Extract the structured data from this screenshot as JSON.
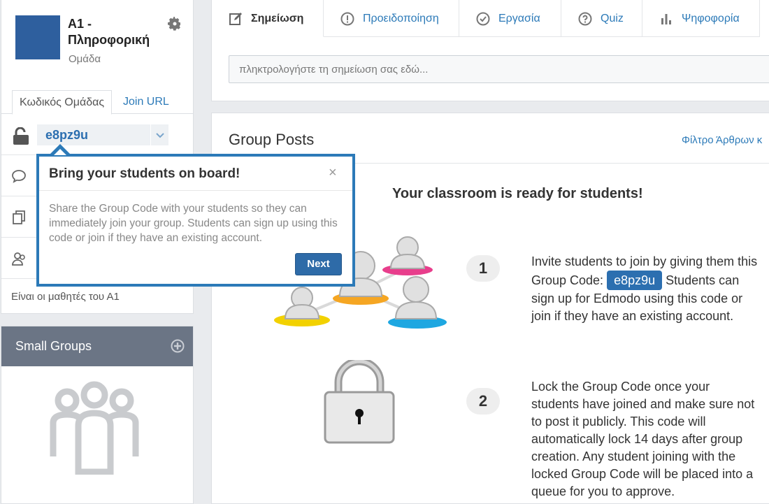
{
  "group": {
    "title": "A1 - Πληροφορική",
    "subtitle": "Ομάδα",
    "tab_code": "Κωδικός Ομάδας",
    "tab_join": "Join URL",
    "code": "e8pz9u",
    "description": "Είναι οι μαθητές του Α1"
  },
  "small_groups": {
    "title": "Small Groups"
  },
  "composer": {
    "tabs": [
      {
        "label": "Σημείωση",
        "icon": "note-icon"
      },
      {
        "label": "Προειδοποίηση",
        "icon": "alert-icon"
      },
      {
        "label": "Εργασία",
        "icon": "assignment-icon"
      },
      {
        "label": "Quiz",
        "icon": "quiz-icon"
      },
      {
        "label": "Ψηφοφορία",
        "icon": "poll-icon"
      }
    ],
    "placeholder": "πληκτρολογήστε τη σημείωση σας εδώ..."
  },
  "posts": {
    "title": "Group Posts",
    "filter": "Φίλτρο Άρθρων κ",
    "ready": "Your classroom is ready for students!",
    "step1_num": "1",
    "step1_before": "Invite students to join by giving them this Group Code: ",
    "step1_code": "e8pz9u",
    "step1_after": " Students can sign up for Edmodo using this code or join if they have an existing account.",
    "step2_num": "2",
    "step2_text": "Lock the Group Code once your students have joined and make sure not to post it publicly. This code will automatically lock 14 days after group creation. Any student joining with the locked Group Code will be placed into a queue for you to approve."
  },
  "popover": {
    "title": "Bring your students on board!",
    "close": "×",
    "body": "Share the Group Code with your students so they can immediately join your group. Students can sign up using this code or join if they have an existing account.",
    "next": "Next"
  },
  "colors": {
    "accent": "#2c7ab8",
    "avatar": "#2e5f9e",
    "sidebar_header": "#6b7585"
  }
}
